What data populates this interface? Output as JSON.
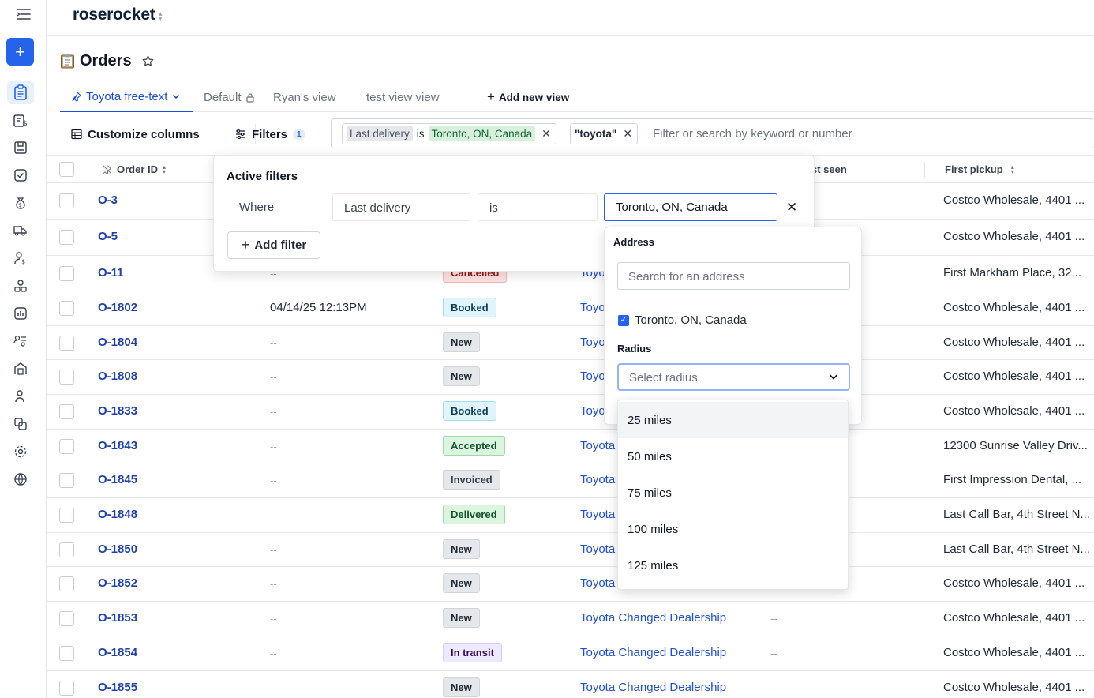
{
  "app": {
    "logo": "roserocket"
  },
  "page": {
    "title": "Orders"
  },
  "tabs": [
    {
      "label": "Toyota free-text"
    },
    {
      "label": "Default"
    },
    {
      "label": "Ryan's view"
    },
    {
      "label": "test view view"
    },
    {
      "label": "Add new view"
    }
  ],
  "toolbar": {
    "customize_label": "Customize columns",
    "filters_label": "Filters",
    "filters_count": "1",
    "chip1": {
      "key": "Last delivery",
      "op": "is",
      "value": "Toronto, ON, Canada"
    },
    "chip2": {
      "value": "\"toyota\""
    },
    "search_placeholder": "Filter or search by keyword or number"
  },
  "columns": {
    "order_id": "Order ID",
    "last_seen": "st seen",
    "first_pickup": "First pickup"
  },
  "rows": [
    {
      "id": "O-3",
      "date": "",
      "status": "",
      "customer": "",
      "seen": "",
      "pickup": "Costco Wholesale, 4401 ..."
    },
    {
      "id": "O-5",
      "date": "",
      "status": "",
      "customer": "",
      "seen": "",
      "pickup": "Costco Wholesale, 4401 ..."
    },
    {
      "id": "O-11",
      "date": "--",
      "status": "Cancelled",
      "customer": "Toyo",
      "seen": "",
      "pickup": "First Markham Place, 32..."
    },
    {
      "id": "O-1802",
      "date": "04/14/25 12:13PM",
      "status": "Booked",
      "customer": "Toyo",
      "seen": "",
      "pickup": "Costco Wholesale, 4401 ..."
    },
    {
      "id": "O-1804",
      "date": "--",
      "status": "New",
      "customer": "Toyo",
      "seen": "",
      "pickup": "Costco Wholesale, 4401 ..."
    },
    {
      "id": "O-1808",
      "date": "--",
      "status": "New",
      "customer": "Toyo",
      "seen": "",
      "pickup": "Costco Wholesale, 4401 ..."
    },
    {
      "id": "O-1833",
      "date": "--",
      "status": "Booked",
      "customer": "Toyo",
      "seen": "",
      "pickup": "Costco Wholesale, 4401 ..."
    },
    {
      "id": "O-1843",
      "date": "--",
      "status": "Accepted",
      "customer": "Toyota",
      "seen": "",
      "pickup": "12300 Sunrise Valley Driv..."
    },
    {
      "id": "O-1845",
      "date": "--",
      "status": "Invoiced",
      "customer": "Toyota",
      "seen": "",
      "pickup": "First Impression Dental, ..."
    },
    {
      "id": "O-1848",
      "date": "--",
      "status": "Delivered",
      "customer": "Toyota",
      "seen": "",
      "pickup": "Last Call Bar, 4th Street N..."
    },
    {
      "id": "O-1850",
      "date": "--",
      "status": "New",
      "customer": "Toyota",
      "seen": "",
      "pickup": "Last Call Bar, 4th Street N..."
    },
    {
      "id": "O-1852",
      "date": "--",
      "status": "New",
      "customer": "Toyota",
      "seen": "",
      "pickup": "Costco Wholesale, 4401 ..."
    },
    {
      "id": "O-1853",
      "date": "--",
      "status": "New",
      "customer": "Toyota Changed Dealership",
      "seen": "--",
      "pickup": "Costco Wholesale, 4401 ..."
    },
    {
      "id": "O-1854",
      "date": "--",
      "status": "In transit",
      "customer": "Toyota Changed Dealership",
      "seen": "--",
      "pickup": "Costco Wholesale, 4401 ..."
    },
    {
      "id": "O-1855",
      "date": "--",
      "status": "New",
      "customer": "Toyota Changed Dealership",
      "seen": "--",
      "pickup": "Costco Wholesale, 4401 ..."
    }
  ],
  "filter_popover": {
    "title": "Active filters",
    "where": "Where",
    "field": "Last delivery",
    "operator": "is",
    "value": "Toronto, ON, Canada",
    "add_filter": "Add filter"
  },
  "address_dropdown": {
    "label": "Address",
    "search_placeholder": "Search for an address",
    "checked_option": "Toronto, ON, Canada",
    "radius_label": "Radius",
    "radius_placeholder": "Select radius",
    "radius_options": [
      "25 miles",
      "50 miles",
      "75 miles",
      "100 miles",
      "125 miles"
    ]
  },
  "colors": {
    "accent": "#2563eb",
    "link": "#1e40af"
  }
}
